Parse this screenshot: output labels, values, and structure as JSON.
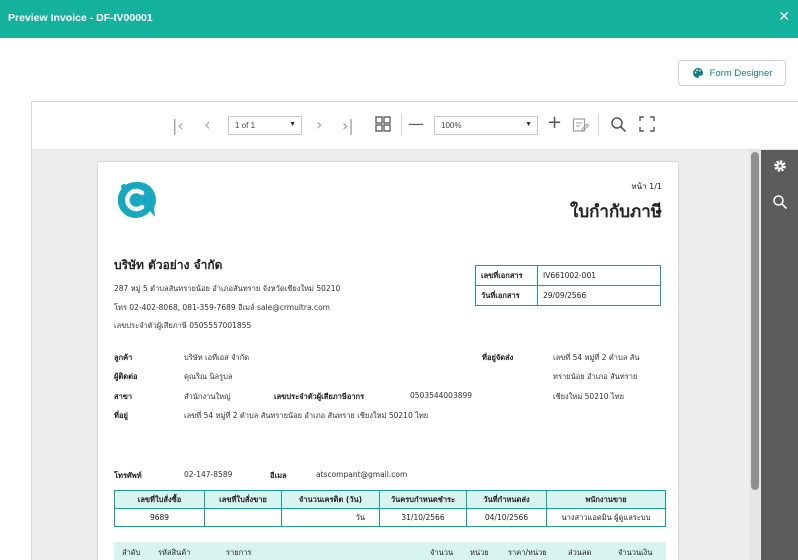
{
  "window": {
    "title": "Preview Invoice - DF-IV00001",
    "close_icon": "close-icon"
  },
  "designer_button": {
    "label": "Form Designer",
    "icon": "palette-icon"
  },
  "toolbar": {
    "page_value": "1 of 1",
    "zoom_value": "100%",
    "icons": [
      "first-page-icon",
      "prev-page-icon",
      "next-page-icon",
      "last-page-icon",
      "multi-page-icon",
      "zoom-out-icon",
      "zoom-in-icon",
      "edit-fields-icon",
      "search-icon",
      "fullscreen-icon"
    ]
  },
  "side_panel": {
    "icons": [
      "settings-icon",
      "search-icon"
    ]
  },
  "document": {
    "page_number": "หน้า 1/1",
    "title": "ใบกำกับภาษี",
    "company": {
      "name": "บริษัท ตัวอย่าง จำกัด",
      "address": "287 หมู่ 5 ตำบลสันทรายน้อย อำเภอสันทราย จังหวัดเชียงใหม่ 50210",
      "contact": "โทร 02-402-8068, 081-359-7689 อีเมล์ sale@crmultra.com",
      "tax_id": "เลขประจำตัวผู้เสียภาษี 0505557001855"
    },
    "doc_info": [
      {
        "label": "เลขที่เอกสาร",
        "value": "IV661002-001"
      },
      {
        "label": "วันที่เอกสาร",
        "value": "29/09/2566"
      }
    ],
    "customer": {
      "customer_label": "ลูกค้า",
      "customer_value": "บริษัท เอทีเอส จำกัด",
      "contact_label": "ผู้ติดต่อ",
      "contact_value": "คุณริณ นิลรูบล",
      "branch_label": "สาขา",
      "branch_value": "สำนักงานใหญ่",
      "taxid_label": "เลขประจำตัวผู้เสียภาษีอากร",
      "taxid_value": "0503544003899",
      "address_label": "ที่อยู่",
      "address_value": "เลขที่ 54 หมู่ที่ 2 ตำบล สันทรายน้อย อำเภอ สันทราย เชียงใหม่ 50210 ไทย",
      "phone_label": "โทรศัพท์",
      "phone_value": "02-147-8589",
      "email_label": "อีเมล",
      "email_value": "atscompant@gmail.com"
    },
    "shipping": {
      "label": "ที่อยู่จัดส่ง",
      "line1": "เลขที่ 54 หมู่ที่ 2 ตำบล สัน",
      "line2": "ทรายน้อย อำเภอ สันทราย",
      "line3": "เชียงใหม่ 50210 ไทย"
    },
    "po_table": {
      "headers": [
        "เลขที่ใบสั่งซื้อ",
        "เลขที่ใบสั่งขาย",
        "จำนวนเครดิต (วัน)",
        "วันครบกำหนดชำระ",
        "วันที่กำหนดส่ง",
        "พนักงานขาย"
      ],
      "row": [
        "9689",
        "",
        "วัน",
        "31/10/2566",
        "04/10/2566",
        "นางสาวแอดมิน ผู้ดูแลระบบ"
      ]
    },
    "items_header": [
      "ลำดับ",
      "รหัสสินค้า",
      "รายการ",
      "จำนวน",
      "หน่วย",
      "ราคา/หน่วย",
      "ส่วนลด",
      "จำนวนเงิน"
    ]
  }
}
